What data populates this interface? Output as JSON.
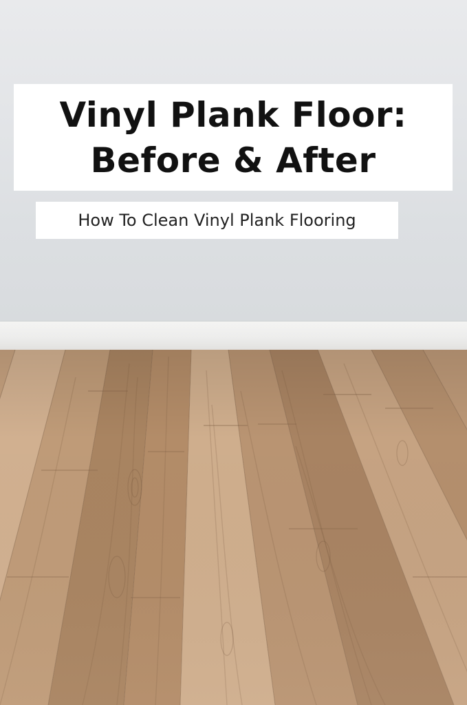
{
  "title": {
    "line1": "Vinyl Plank Floor:",
    "line2": "Before & After"
  },
  "subtitle": "How To Clean Vinyl Plank Flooring",
  "colors": {
    "wall": "#e3e5e8",
    "baseboard": "#efefee",
    "wood_light": "#c9a684",
    "wood_mid": "#b8926d",
    "wood_dark": "#9c7656",
    "title_text": "#111111",
    "label_background": "#ffffff"
  }
}
